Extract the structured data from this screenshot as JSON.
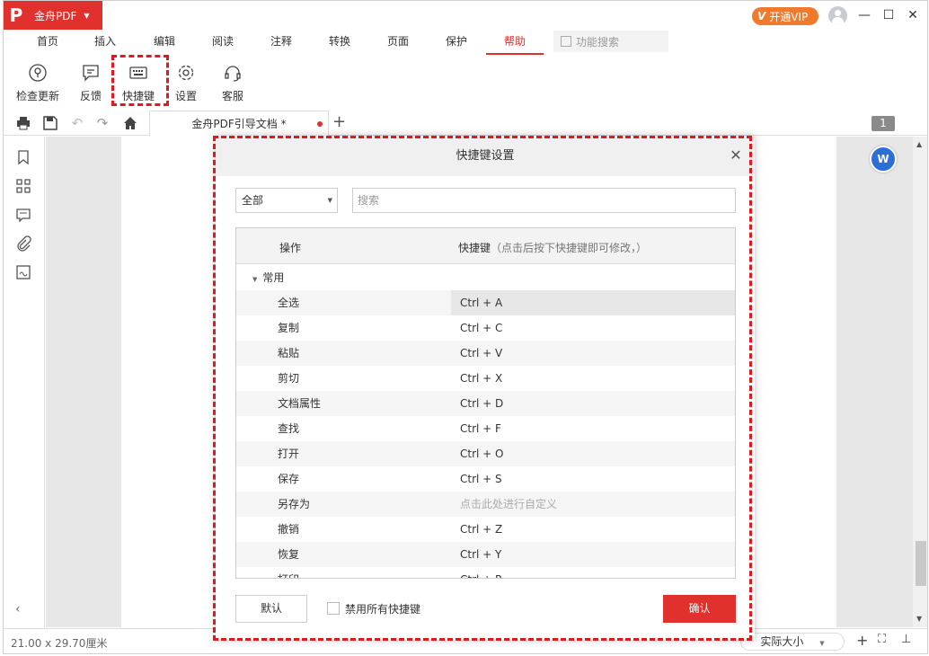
{
  "app": {
    "name": "金舟PDF",
    "vip_label": "开通VIP",
    "vip_badge": "V"
  },
  "menu": {
    "items": [
      "首页",
      "插入",
      "编辑",
      "阅读",
      "注释",
      "转换",
      "页面",
      "保护",
      "帮助"
    ],
    "active": "帮助",
    "search_placeholder": "功能搜索"
  },
  "toolbar": {
    "items": [
      {
        "label": "检查更新",
        "icon": "upgrade-icon"
      },
      {
        "label": "反馈",
        "icon": "feedback-icon"
      },
      {
        "label": "快捷键",
        "icon": "keyboard-icon"
      },
      {
        "label": "设置",
        "icon": "gear-icon"
      },
      {
        "label": "客服",
        "icon": "headset-icon"
      }
    ]
  },
  "tabs": {
    "doc_title": "金舟PDF引导文档 *",
    "page_number": "1"
  },
  "status": {
    "page_size": "21.00 x 29.70厘米",
    "zoom_label": "实际大小"
  },
  "dialog": {
    "title": "快捷键设置",
    "filter_value": "全部",
    "search_placeholder": "搜索",
    "col_operation": "操作",
    "col_shortcut": "快捷键",
    "col_shortcut_hint": "（点击后按下快捷键即可修改，）",
    "group_name": "常用",
    "rows": [
      {
        "op": "全选",
        "key": "Ctrl + A"
      },
      {
        "op": "复制",
        "key": "Ctrl + C"
      },
      {
        "op": "粘贴",
        "key": "Ctrl + V"
      },
      {
        "op": "剪切",
        "key": "Ctrl + X"
      },
      {
        "op": "文档属性",
        "key": "Ctrl + D"
      },
      {
        "op": "查找",
        "key": "Ctrl + F"
      },
      {
        "op": "打开",
        "key": "Ctrl + O"
      },
      {
        "op": "保存",
        "key": "Ctrl + S"
      },
      {
        "op": "另存为",
        "key": "点击此处进行自定义"
      },
      {
        "op": "撤销",
        "key": "Ctrl + Z"
      },
      {
        "op": "恢复",
        "key": "Ctrl + Y"
      },
      {
        "op": "打印",
        "key": "Ctrl + P"
      }
    ],
    "btn_default": "默认",
    "disable_all_label": "禁用所有快捷键",
    "btn_confirm": "确认"
  },
  "colors": {
    "brand": "#e0312c",
    "vip": "#f07a2b",
    "highlight": "#e0191e"
  }
}
